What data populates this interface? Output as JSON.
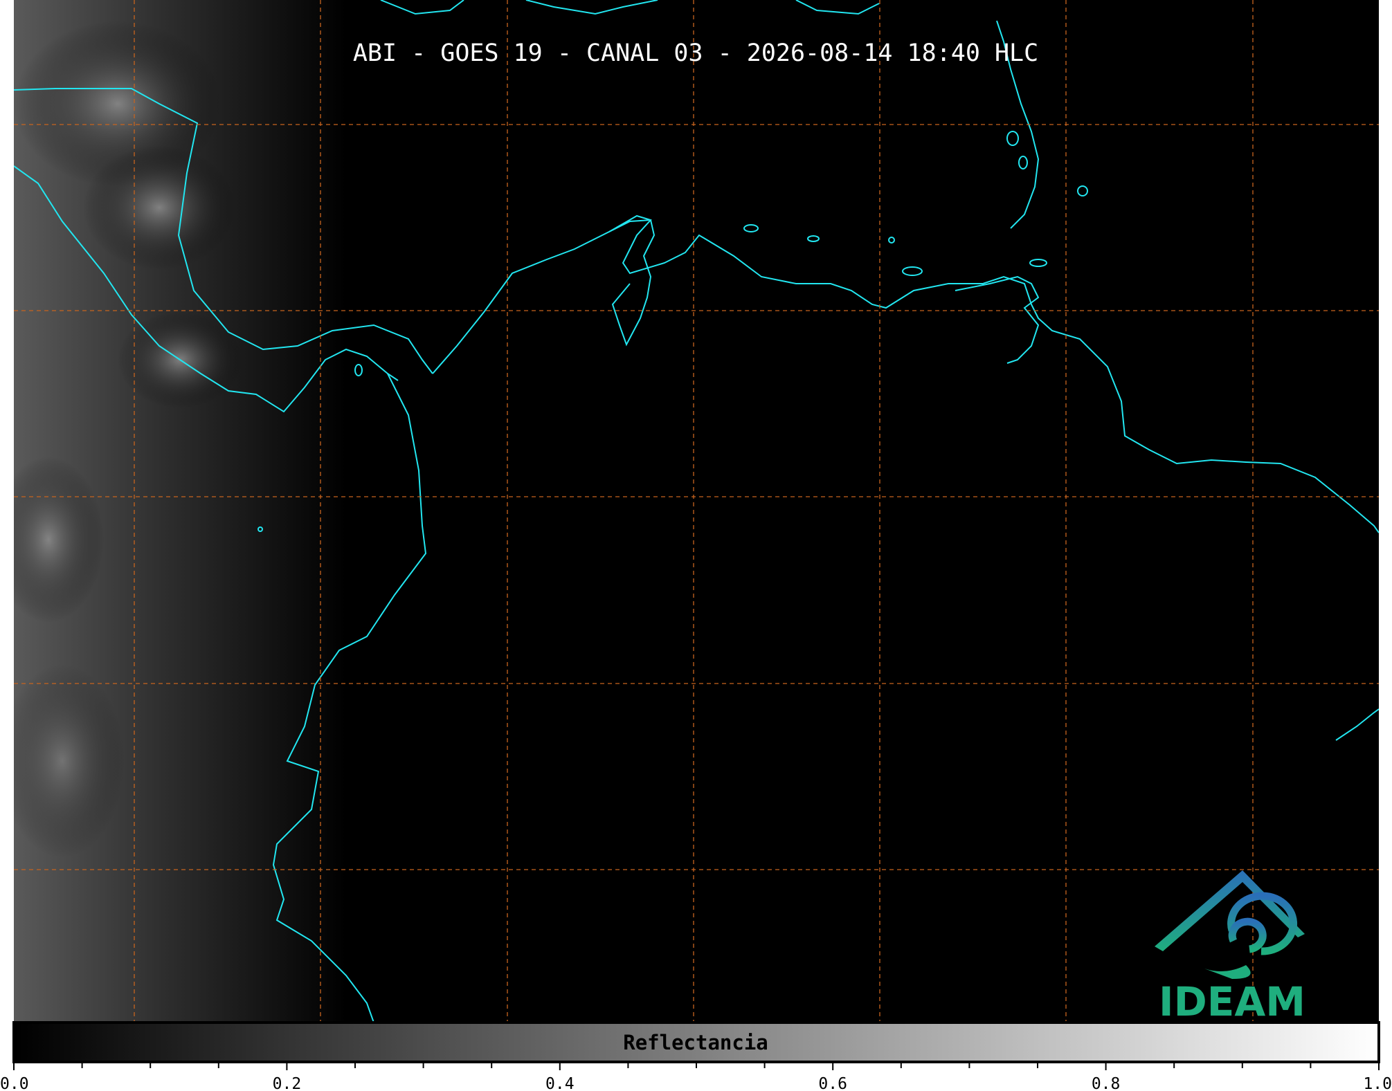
{
  "title": "ABI - GOES 19 - CANAL 03 - 2026-08-14 18:40 HLC",
  "colorbar": {
    "label": "Reflectancia",
    "range": [
      0.0,
      1.0
    ],
    "major_ticks": [
      "0.0",
      "0.2",
      "0.4",
      "0.6",
      "0.8",
      "1.0"
    ],
    "colors": [
      "#000000",
      "#ffffff"
    ]
  },
  "logo": {
    "text": "IDEAM",
    "colors": [
      "#2a6fb8",
      "#1fae7e"
    ]
  },
  "map_colors": {
    "background": "#000000",
    "coastline": "#22e6f0",
    "grid": "#c8641e"
  },
  "grid": {
    "style": "dashed",
    "visible": true
  }
}
